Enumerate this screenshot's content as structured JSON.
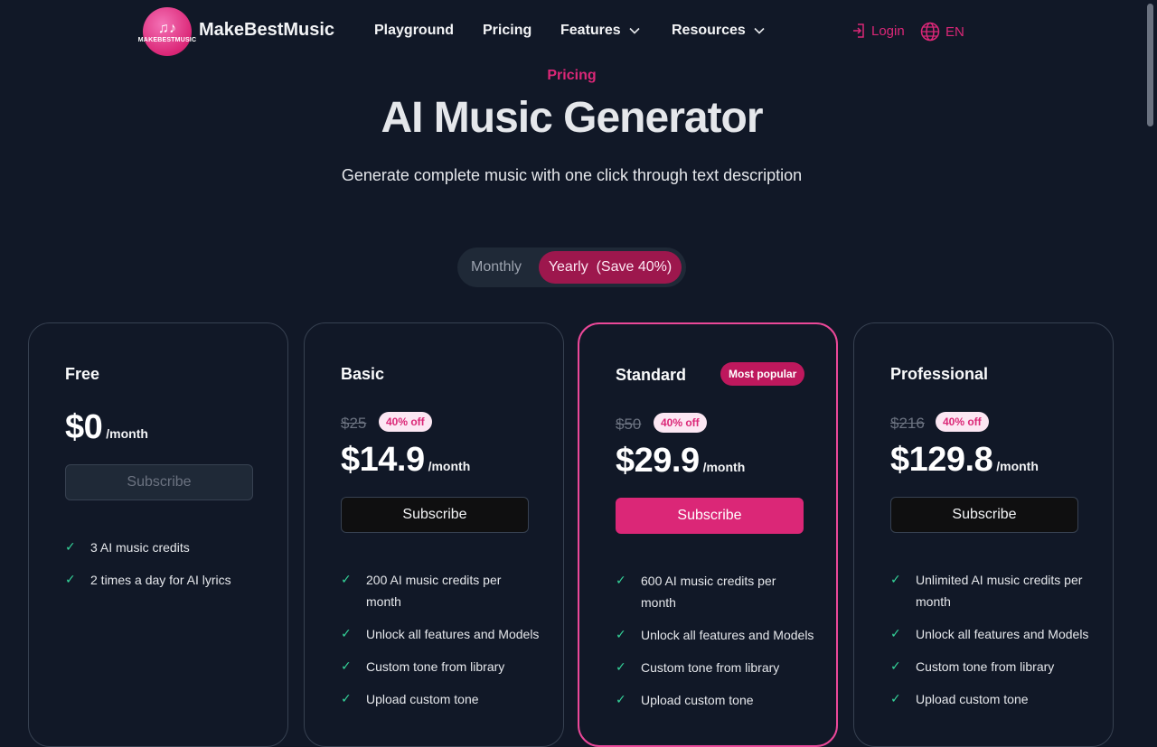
{
  "header": {
    "brand": "MakeBestMusic",
    "logo_text": "MAKEBESTMUSIC",
    "nav": [
      {
        "label": "Playground",
        "icon": null
      },
      {
        "label": "Pricing",
        "icon": null
      },
      {
        "label": "Features",
        "icon": "chevron-down-icon"
      },
      {
        "label": "Resources",
        "icon": "chevron-down-icon"
      }
    ],
    "login": "Login",
    "language": "EN"
  },
  "hero": {
    "eyebrow": "Pricing",
    "title": "AI Music Generator",
    "subtitle": "Generate complete music with one click through text description"
  },
  "billing_toggle": {
    "monthly": "Monthly",
    "yearly": "Yearly  (Save 40%)",
    "selected": "yearly"
  },
  "plans": [
    {
      "name": "Free",
      "badge": null,
      "original_price": null,
      "discount": null,
      "price": "$0",
      "period": "/month",
      "button": "Subscribe",
      "button_style": "disabled",
      "features": [
        "3 AI music credits",
        "2 times a day for AI lyrics"
      ]
    },
    {
      "name": "Basic",
      "badge": null,
      "original_price": "$25",
      "discount": "40% off",
      "price": "$14.9",
      "period": "/month",
      "button": "Subscribe",
      "button_style": "dark",
      "features": [
        "200 AI music credits per month",
        "Unlock all features and Models",
        "Custom tone from library",
        "Upload custom tone"
      ]
    },
    {
      "name": "Standard",
      "badge": "Most popular",
      "original_price": "$50",
      "discount": "40% off",
      "price": "$29.9",
      "period": "/month",
      "button": "Subscribe",
      "button_style": "pink",
      "features": [
        "600 AI music credits per month",
        "Unlock all features and Models",
        "Custom tone from library",
        "Upload custom tone"
      ]
    },
    {
      "name": "Professional",
      "badge": null,
      "original_price": "$216",
      "discount": "40% off",
      "price": "$129.8",
      "period": "/month",
      "button": "Subscribe",
      "button_style": "dark",
      "features": [
        "Unlimited AI music credits per month",
        "Unlock all features and Models",
        "Custom tone from library",
        "Upload custom tone"
      ]
    }
  ],
  "colors": {
    "background": "#111827",
    "accent": "#db2777",
    "check": "#34d399"
  }
}
